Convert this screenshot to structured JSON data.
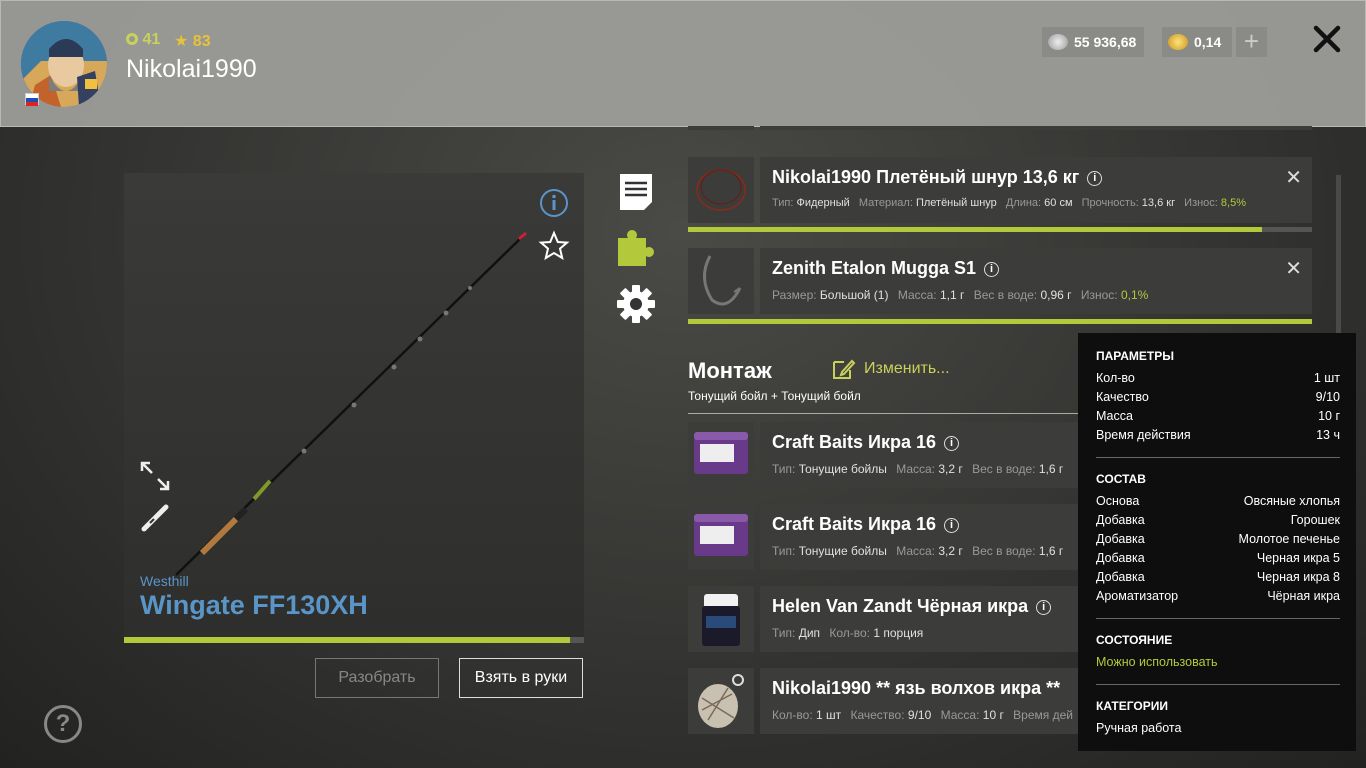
{
  "header": {
    "level": "41",
    "rank": "83",
    "nickname": "Nikolai1990",
    "silver": "55 936,68",
    "gold": "0,14",
    "plus": "+",
    "close": "✕"
  },
  "rod": {
    "brand": "Westhill",
    "name": "Wingate FF130XH",
    "condition": 0.97,
    "disassemble_label": "Разобрать",
    "take_label": "Взять в руки"
  },
  "items": [
    {
      "title": "Nikolai1990 Плетёный шнур 13,6 кг",
      "props": [
        {
          "k": "Тип:",
          "v": "Фидерный"
        },
        {
          "k": "Материал:",
          "v": "Плетёный шнур"
        },
        {
          "k": "Длина:",
          "v": "60 см"
        },
        {
          "k": "Прочность:",
          "v": "13,6 кг"
        },
        {
          "k": "Износ:",
          "v": "8,5%"
        }
      ],
      "bar": 0.92
    },
    {
      "title": "Zenith Etalon Mugga S1",
      "props": [
        {
          "k": "Размер:",
          "v": "Большой (1)"
        },
        {
          "k": "Масса:",
          "v": "1,1 г"
        },
        {
          "k": "Вес в воде:",
          "v": "0,96 г"
        },
        {
          "k": "Износ:",
          "v": "0,1%"
        }
      ],
      "bar": 1.0
    }
  ],
  "montage": {
    "title": "Монтаж",
    "edit_label": "Изменить...",
    "subtitle": "Тонущий бойл  +  Тонущий бойл"
  },
  "baits": [
    {
      "title": "Craft Baits Икра 16",
      "props": [
        {
          "k": "Тип:",
          "v": "Тонущие бойлы"
        },
        {
          "k": "Масса:",
          "v": "3,2 г"
        },
        {
          "k": "Вес в воде:",
          "v": "1,6 г"
        }
      ]
    },
    {
      "title": "Craft Baits Икра 16",
      "props": [
        {
          "k": "Тип:",
          "v": "Тонущие бойлы"
        },
        {
          "k": "Масса:",
          "v": "3,2 г"
        },
        {
          "k": "Вес в воде:",
          "v": "1,6 г"
        }
      ]
    },
    {
      "title": "Helen Van Zandt Чёрная икра",
      "props": [
        {
          "k": "Тип:",
          "v": "Дип"
        },
        {
          "k": "Кол-во:",
          "v": "1 порция"
        }
      ]
    },
    {
      "title": "Nikolai1990 ** язь волхов икра **",
      "props": [
        {
          "k": "Кол-во:",
          "v": "1 шт"
        },
        {
          "k": "Качество:",
          "v": "9/10"
        },
        {
          "k": "Масса:",
          "v": "10 г"
        },
        {
          "k": "Время дей",
          "v": ""
        }
      ]
    }
  ],
  "tooltip": {
    "params_title": "ПАРАМЕТРЫ",
    "params": [
      {
        "k": "Кол-во",
        "v": "1 шт"
      },
      {
        "k": "Качество",
        "v": "9/10"
      },
      {
        "k": "Масса",
        "v": "10 г"
      },
      {
        "k": "Время действия",
        "v": "13 ч"
      }
    ],
    "composition_title": "СОСТАВ",
    "composition": [
      {
        "k": "Основа",
        "v": "Овсяные хлопья"
      },
      {
        "k": "Добавка",
        "v": "Горошек"
      },
      {
        "k": "Добавка",
        "v": "Молотое печенье"
      },
      {
        "k": "Добавка",
        "v": "Черная икра 5"
      },
      {
        "k": "Добавка",
        "v": "Черная икра 8"
      },
      {
        "k": "Ароматизатор",
        "v": "Чёрная икра"
      }
    ],
    "state_title": "СОСТОЯНИЕ",
    "state_value": "Можно использовать",
    "categories_title": "КАТЕГОРИИ",
    "categories_value": "Ручная работа"
  },
  "help_label": "?",
  "colors": {
    "accent": "#b4c83c",
    "rod_name": "#5a95c8",
    "header_bg": "#a0a09c"
  },
  "icons": [
    "info-icon",
    "star-icon",
    "expand-icon",
    "rod-icon",
    "document-icon",
    "puzzle-icon",
    "gear-icon",
    "edit-icon",
    "close-icon",
    "help-icon",
    "silver-coin-icon",
    "gold-coin-icon"
  ]
}
